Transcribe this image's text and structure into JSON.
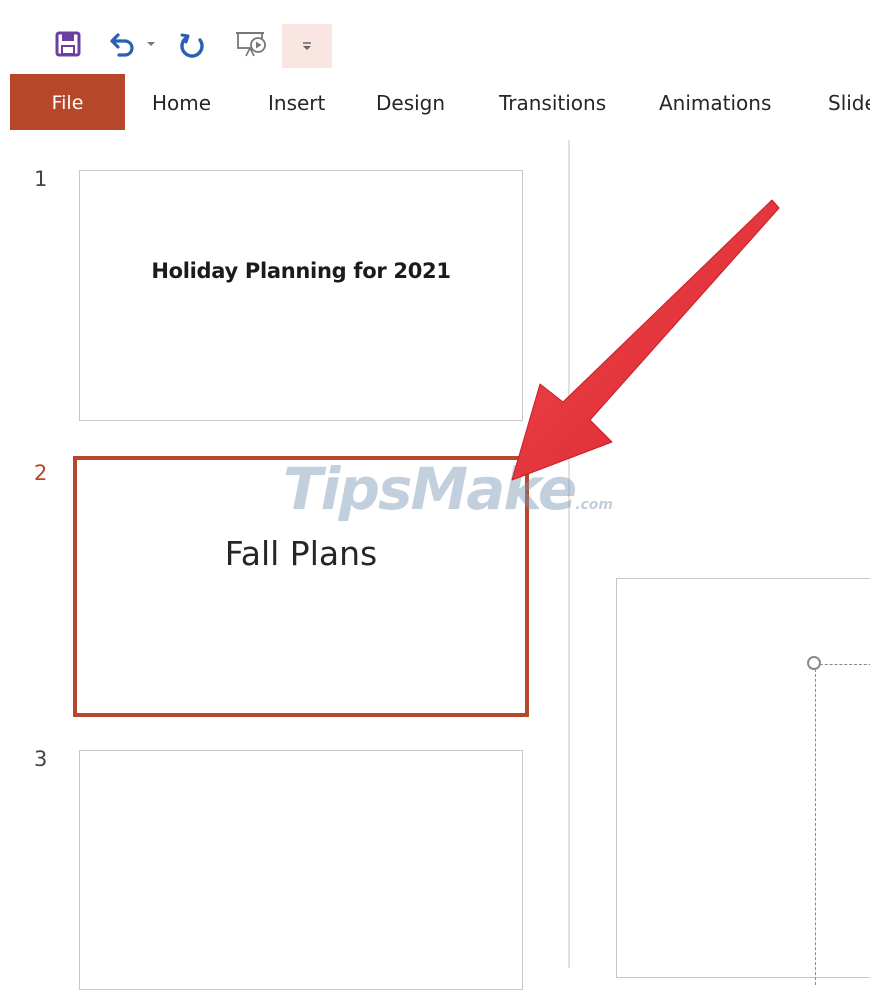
{
  "quick_access": {
    "save_icon": "save-icon",
    "undo_icon": "undo-icon",
    "undo_dropdown_icon": "chevron-down-icon",
    "redo_icon": "redo-icon",
    "slideshow_icon": "slideshow-from-beginning-icon",
    "customize_icon": "customize-toolbar-icon"
  },
  "ribbon": {
    "tabs": [
      {
        "label": "File"
      },
      {
        "label": "Home"
      },
      {
        "label": "Insert"
      },
      {
        "label": "Design"
      },
      {
        "label": "Transitions"
      },
      {
        "label": "Animations"
      },
      {
        "label": "Slide"
      }
    ]
  },
  "thumbnails": [
    {
      "number": "1",
      "title": "Holiday Planning for 2021",
      "selected": false
    },
    {
      "number": "2",
      "title": "Fall Plans",
      "selected": true
    },
    {
      "number": "3",
      "title": "",
      "selected": false
    }
  ],
  "watermark": {
    "text": "TipsMake",
    "suffix": ".com"
  },
  "colors": {
    "accent": "#b7472a",
    "save_icon": "#6b3fa0",
    "undo_icon": "#2b5fb4",
    "arrow": "#e8323a"
  }
}
